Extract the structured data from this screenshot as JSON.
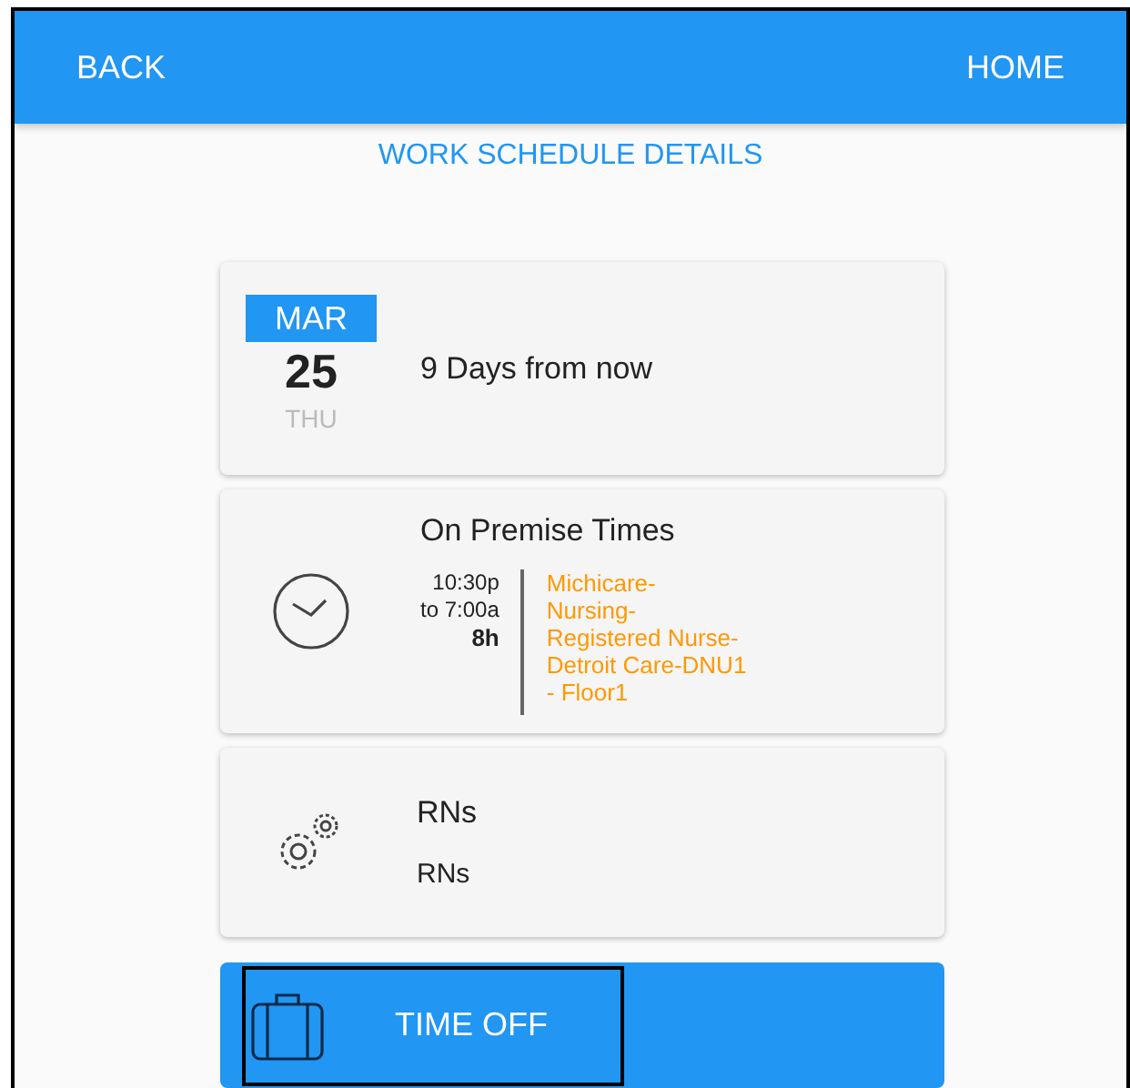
{
  "header": {
    "back": "BACK",
    "home": "HOME"
  },
  "title": "WORK SCHEDULE DETAILS",
  "date_card": {
    "month": "MAR",
    "day": "25",
    "weekday": "THU",
    "relative": "9 Days from now"
  },
  "times_card": {
    "title": "On Premise Times",
    "start": "10:30p",
    "end": "to 7:00a",
    "duration": "8h",
    "location": "Michicare-\nNursing-\nRegistered Nurse-\nDetroit Care-DNU1\n- Floor1"
  },
  "role_card": {
    "title": "RNs",
    "subtitle": "RNs"
  },
  "action_button": {
    "label": "TIME OFF",
    "focused": true
  }
}
